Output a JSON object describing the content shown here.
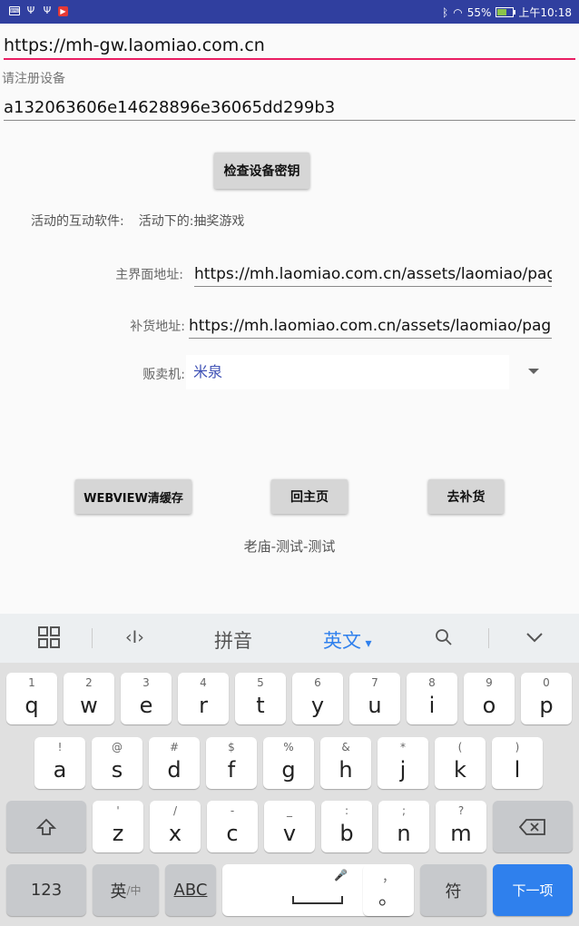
{
  "status_bar": {
    "battery": "55%",
    "time": "上午10:18"
  },
  "server_url": "https://mh-gw.laomiao.com.cn",
  "register_label": "请注册设备",
  "device_key": "a132063606e14628896e36065dd299b3",
  "check_key_button": "检查设备密钥",
  "active_software": {
    "label": "活动的互动软件:",
    "value": "活动下的:抽奖游戏"
  },
  "main_url": {
    "label": "主界面地址:",
    "value": "https://mh.laomiao.com.cn/assets/laomiao/pages/"
  },
  "restock_url": {
    "label": "补货地址:",
    "value": "https://mh.laomiao.com.cn/assets/laomiao/pages/"
  },
  "vending": {
    "label": "贩卖机:",
    "selected": "米泉"
  },
  "buttons": {
    "clear_cache": "WEBVIEW清缓存",
    "home": "回主页",
    "restock": "去补货"
  },
  "footer": "老庙-测试-测试",
  "keyboard": {
    "toolbar": {
      "pinyin": "拼音",
      "english": "英文"
    },
    "row1": [
      {
        "hint": "1",
        "key": "q"
      },
      {
        "hint": "2",
        "key": "w"
      },
      {
        "hint": "3",
        "key": "e"
      },
      {
        "hint": "4",
        "key": "r"
      },
      {
        "hint": "5",
        "key": "t"
      },
      {
        "hint": "6",
        "key": "y"
      },
      {
        "hint": "7",
        "key": "u"
      },
      {
        "hint": "8",
        "key": "i"
      },
      {
        "hint": "9",
        "key": "o"
      },
      {
        "hint": "0",
        "key": "p"
      }
    ],
    "row2": [
      {
        "hint": "!",
        "key": "a"
      },
      {
        "hint": "@",
        "key": "s"
      },
      {
        "hint": "#",
        "key": "d"
      },
      {
        "hint": "$",
        "key": "f"
      },
      {
        "hint": "%",
        "key": "g"
      },
      {
        "hint": "&",
        "key": "h"
      },
      {
        "hint": "*",
        "key": "j"
      },
      {
        "hint": "(",
        "key": "k"
      },
      {
        "hint": ")",
        "key": "l"
      }
    ],
    "row3": [
      {
        "hint": "'",
        "key": "z"
      },
      {
        "hint": "/",
        "key": "x"
      },
      {
        "hint": "-",
        "key": "c"
      },
      {
        "hint": "_",
        "key": "v"
      },
      {
        "hint": ":",
        "key": "b"
      },
      {
        "hint": ";",
        "key": "n"
      },
      {
        "hint": "?",
        "key": "m"
      }
    ],
    "bottom": {
      "num": "123",
      "lang": "英",
      "lang_sub": "/中",
      "abc": "ABC",
      "comma_hint": "，",
      "period": "。",
      "symbol": "符",
      "next": "下一项"
    }
  }
}
